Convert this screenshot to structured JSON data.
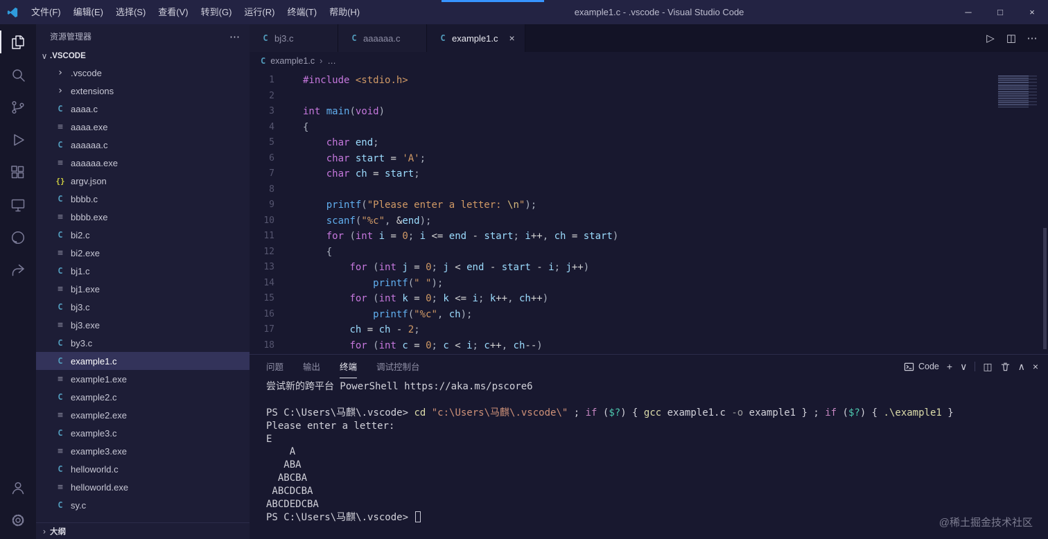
{
  "title_bar": {
    "title": "example1.c - .vscode - Visual Studio Code",
    "menus": [
      {
        "name": "file",
        "label": "文件(F)"
      },
      {
        "name": "edit",
        "label": "编辑(E)"
      },
      {
        "name": "selection",
        "label": "选择(S)"
      },
      {
        "name": "view",
        "label": "查看(V)"
      },
      {
        "name": "go",
        "label": "转到(G)"
      },
      {
        "name": "run",
        "label": "运行(R)"
      },
      {
        "name": "terminal",
        "label": "终端(T)"
      },
      {
        "name": "help",
        "label": "帮助(H)"
      }
    ],
    "window_controls": [
      {
        "name": "minimize",
        "glyph": "─"
      },
      {
        "name": "maximize",
        "glyph": "□"
      },
      {
        "name": "close-window",
        "glyph": "×"
      }
    ]
  },
  "activity_bar": {
    "top": [
      {
        "name": "explorer",
        "active": true
      },
      {
        "name": "search",
        "active": false
      },
      {
        "name": "source-control",
        "active": false
      },
      {
        "name": "run-and-debug",
        "active": false
      },
      {
        "name": "extensions",
        "active": false
      },
      {
        "name": "remote-explorer",
        "active": false
      },
      {
        "name": "github",
        "active": false
      },
      {
        "name": "live-share",
        "active": false
      }
    ],
    "bottom": [
      {
        "name": "account",
        "active": false
      },
      {
        "name": "settings-gear",
        "active": false
      }
    ]
  },
  "icon_glyphs": {
    "folder": "›",
    "c": "C",
    "exe": "≡",
    "json": "{}"
  },
  "sidebar": {
    "header": "资源管理器",
    "header_more": "⋯",
    "section": {
      "label": ".VSCODE",
      "chevron": "∨"
    },
    "items": [
      {
        "label": ".vscode",
        "icon": "folder",
        "selected": false
      },
      {
        "label": "extensions",
        "icon": "folder",
        "selected": false
      },
      {
        "label": "aaaa.c",
        "icon": "c",
        "selected": false
      },
      {
        "label": "aaaa.exe",
        "icon": "exe",
        "selected": false
      },
      {
        "label": "aaaaaa.c",
        "icon": "c",
        "selected": false
      },
      {
        "label": "aaaaaa.exe",
        "icon": "exe",
        "selected": false
      },
      {
        "label": "argv.json",
        "icon": "json",
        "selected": false
      },
      {
        "label": "bbbb.c",
        "icon": "c",
        "selected": false
      },
      {
        "label": "bbbb.exe",
        "icon": "exe",
        "selected": false
      },
      {
        "label": "bi2.c",
        "icon": "c",
        "selected": false
      },
      {
        "label": "bi2.exe",
        "icon": "exe",
        "selected": false
      },
      {
        "label": "bj1.c",
        "icon": "c",
        "selected": false
      },
      {
        "label": "bj1.exe",
        "icon": "exe",
        "selected": false
      },
      {
        "label": "bj3.c",
        "icon": "c",
        "selected": false
      },
      {
        "label": "bj3.exe",
        "icon": "exe",
        "selected": false
      },
      {
        "label": "by3.c",
        "icon": "c",
        "selected": false
      },
      {
        "label": "example1.c",
        "icon": "c",
        "selected": true
      },
      {
        "label": "example1.exe",
        "icon": "exe",
        "selected": false
      },
      {
        "label": "example2.c",
        "icon": "c",
        "selected": false
      },
      {
        "label": "example2.exe",
        "icon": "exe",
        "selected": false
      },
      {
        "label": "example3.c",
        "icon": "c",
        "selected": false
      },
      {
        "label": "example3.exe",
        "icon": "exe",
        "selected": false
      },
      {
        "label": "helloworld.c",
        "icon": "c",
        "selected": false
      },
      {
        "label": "helloworld.exe",
        "icon": "exe",
        "selected": false
      },
      {
        "label": "sy.c",
        "icon": "c",
        "selected": false
      }
    ],
    "outline": {
      "label": "大纲",
      "chevron": "›"
    }
  },
  "editor_tabs": [
    {
      "label": "bj3.c",
      "icon": "c",
      "active": false
    },
    {
      "label": "aaaaaa.c",
      "icon": "c",
      "active": false
    },
    {
      "label": "example1.c",
      "icon": "c",
      "active": true,
      "close": "×"
    }
  ],
  "editor_actions": [
    {
      "name": "run-file",
      "glyph": "▷"
    },
    {
      "name": "split-editor",
      "glyph": "◫"
    },
    {
      "name": "more-actions",
      "glyph": "⋯"
    }
  ],
  "breadcrumb": {
    "file": "example1.c",
    "sep": "›",
    "more": "…"
  },
  "editor": {
    "lines": [
      {
        "n": 1,
        "toks": [
          [
            "kw",
            "#include"
          ],
          [
            "pl",
            " "
          ],
          [
            "str",
            "<stdio.h>"
          ]
        ]
      },
      {
        "n": 2,
        "toks": []
      },
      {
        "n": 3,
        "toks": [
          [
            "kw",
            "int"
          ],
          [
            "pl",
            " "
          ],
          [
            "fn",
            "main"
          ],
          [
            "pl",
            "("
          ],
          [
            "kw",
            "void"
          ],
          [
            "pl",
            ")"
          ]
        ]
      },
      {
        "n": 4,
        "toks": [
          [
            "pl",
            "{"
          ]
        ]
      },
      {
        "n": 5,
        "toks": [
          [
            "pl",
            "    "
          ],
          [
            "kw",
            "char"
          ],
          [
            "pl",
            " "
          ],
          [
            "var",
            "end"
          ],
          [
            "pl",
            ";"
          ]
        ]
      },
      {
        "n": 6,
        "toks": [
          [
            "pl",
            "    "
          ],
          [
            "kw",
            "char"
          ],
          [
            "pl",
            " "
          ],
          [
            "var",
            "start"
          ],
          [
            "op",
            " = "
          ],
          [
            "str",
            "'A'"
          ],
          [
            "pl",
            ";"
          ]
        ]
      },
      {
        "n": 7,
        "toks": [
          [
            "pl",
            "    "
          ],
          [
            "kw",
            "char"
          ],
          [
            "pl",
            " "
          ],
          [
            "var",
            "ch"
          ],
          [
            "op",
            " = "
          ],
          [
            "var",
            "start"
          ],
          [
            "pl",
            ";"
          ]
        ]
      },
      {
        "n": 8,
        "toks": []
      },
      {
        "n": 9,
        "toks": [
          [
            "pl",
            "    "
          ],
          [
            "fn",
            "printf"
          ],
          [
            "pl",
            "("
          ],
          [
            "str",
            "\"Please enter a letter: "
          ],
          [
            "esc",
            "\\n"
          ],
          [
            "str",
            "\""
          ],
          [
            "pl",
            ");"
          ]
        ]
      },
      {
        "n": 10,
        "toks": [
          [
            "pl",
            "    "
          ],
          [
            "fn",
            "scanf"
          ],
          [
            "pl",
            "("
          ],
          [
            "str",
            "\"%c\""
          ],
          [
            "pl",
            ", "
          ],
          [
            "op",
            "&"
          ],
          [
            "var",
            "end"
          ],
          [
            "pl",
            ");"
          ]
        ]
      },
      {
        "n": 11,
        "toks": [
          [
            "pl",
            "    "
          ],
          [
            "kw",
            "for"
          ],
          [
            "pl",
            " ("
          ],
          [
            "kw",
            "int"
          ],
          [
            "pl",
            " "
          ],
          [
            "var",
            "i"
          ],
          [
            "op",
            " = "
          ],
          [
            "num",
            "0"
          ],
          [
            "pl",
            "; "
          ],
          [
            "var",
            "i"
          ],
          [
            "op",
            " <= "
          ],
          [
            "var",
            "end"
          ],
          [
            "op",
            " - "
          ],
          [
            "var",
            "start"
          ],
          [
            "pl",
            "; "
          ],
          [
            "var",
            "i"
          ],
          [
            "op",
            "++"
          ],
          [
            "pl",
            ", "
          ],
          [
            "var",
            "ch"
          ],
          [
            "op",
            " = "
          ],
          [
            "var",
            "start"
          ],
          [
            "pl",
            ")"
          ]
        ]
      },
      {
        "n": 12,
        "toks": [
          [
            "pl",
            "    {"
          ]
        ]
      },
      {
        "n": 13,
        "toks": [
          [
            "pl",
            "        "
          ],
          [
            "kw",
            "for"
          ],
          [
            "pl",
            " ("
          ],
          [
            "kw",
            "int"
          ],
          [
            "pl",
            " "
          ],
          [
            "var",
            "j"
          ],
          [
            "op",
            " = "
          ],
          [
            "num",
            "0"
          ],
          [
            "pl",
            "; "
          ],
          [
            "var",
            "j"
          ],
          [
            "op",
            " < "
          ],
          [
            "var",
            "end"
          ],
          [
            "op",
            " - "
          ],
          [
            "var",
            "start"
          ],
          [
            "op",
            " - "
          ],
          [
            "var",
            "i"
          ],
          [
            "pl",
            "; "
          ],
          [
            "var",
            "j"
          ],
          [
            "op",
            "++"
          ],
          [
            "pl",
            ")"
          ]
        ]
      },
      {
        "n": 14,
        "toks": [
          [
            "pl",
            "            "
          ],
          [
            "fn",
            "printf"
          ],
          [
            "pl",
            "("
          ],
          [
            "str",
            "\" \""
          ],
          [
            "pl",
            ");"
          ]
        ]
      },
      {
        "n": 15,
        "toks": [
          [
            "pl",
            "        "
          ],
          [
            "kw",
            "for"
          ],
          [
            "pl",
            " ("
          ],
          [
            "kw",
            "int"
          ],
          [
            "pl",
            " "
          ],
          [
            "var",
            "k"
          ],
          [
            "op",
            " = "
          ],
          [
            "num",
            "0"
          ],
          [
            "pl",
            "; "
          ],
          [
            "var",
            "k"
          ],
          [
            "op",
            " <= "
          ],
          [
            "var",
            "i"
          ],
          [
            "pl",
            "; "
          ],
          [
            "var",
            "k"
          ],
          [
            "op",
            "++"
          ],
          [
            "pl",
            ", "
          ],
          [
            "var",
            "ch"
          ],
          [
            "op",
            "++"
          ],
          [
            "pl",
            ")"
          ]
        ]
      },
      {
        "n": 16,
        "toks": [
          [
            "pl",
            "            "
          ],
          [
            "fn",
            "printf"
          ],
          [
            "pl",
            "("
          ],
          [
            "str",
            "\"%c\""
          ],
          [
            "pl",
            ", "
          ],
          [
            "var",
            "ch"
          ],
          [
            "pl",
            ");"
          ]
        ]
      },
      {
        "n": 17,
        "toks": [
          [
            "pl",
            "        "
          ],
          [
            "var",
            "ch"
          ],
          [
            "op",
            " = "
          ],
          [
            "var",
            "ch"
          ],
          [
            "op",
            " - "
          ],
          [
            "num",
            "2"
          ],
          [
            "pl",
            ";"
          ]
        ]
      },
      {
        "n": 18,
        "toks": [
          [
            "pl",
            "        "
          ],
          [
            "kw",
            "for"
          ],
          [
            "pl",
            " ("
          ],
          [
            "kw",
            "int"
          ],
          [
            "pl",
            " "
          ],
          [
            "var",
            "c"
          ],
          [
            "op",
            " = "
          ],
          [
            "num",
            "0"
          ],
          [
            "pl",
            "; "
          ],
          [
            "var",
            "c"
          ],
          [
            "op",
            " < "
          ],
          [
            "var",
            "i"
          ],
          [
            "pl",
            "; "
          ],
          [
            "var",
            "c"
          ],
          [
            "op",
            "++"
          ],
          [
            "pl",
            ", "
          ],
          [
            "var",
            "ch"
          ],
          [
            "op",
            "--"
          ],
          [
            "pl",
            ")"
          ]
        ]
      }
    ]
  },
  "panel": {
    "tabs": [
      {
        "name": "problems",
        "label": "问题",
        "active": false
      },
      {
        "name": "output",
        "label": "输出",
        "active": false
      },
      {
        "name": "terminal",
        "label": "终端",
        "active": true
      },
      {
        "name": "debug-console",
        "label": "调试控制台",
        "active": false
      }
    ],
    "shell_label": "Code",
    "actions": [
      {
        "name": "new-terminal",
        "glyph": "+"
      },
      {
        "name": "terminal-dropdown",
        "glyph": "∨"
      },
      {
        "name": "separator",
        "glyph": ""
      },
      {
        "name": "split-terminal",
        "glyph": "◫"
      },
      {
        "name": "kill-terminal",
        "glyph": "trash"
      },
      {
        "name": "maximize-panel",
        "glyph": "∧"
      },
      {
        "name": "close-panel",
        "glyph": "×"
      }
    ]
  },
  "terminal": {
    "lines": [
      {
        "toks": [
          [
            "def",
            "尝试新的跨平台 PowerShell https://aka.ms/pscore6"
          ]
        ],
        "cursor": false
      },
      {
        "toks": [],
        "cursor": false
      },
      {
        "toks": [
          [
            "def",
            "PS C:\\Users\\马麒\\.vscode> "
          ],
          [
            "cmd",
            "cd"
          ],
          [
            "def",
            " "
          ],
          [
            "str",
            "\"c:\\Users\\马麒\\.vscode\\\""
          ],
          [
            "def",
            " ; "
          ],
          [
            "kw",
            "if"
          ],
          [
            "def",
            " ("
          ],
          [
            "var",
            "$?"
          ],
          [
            "def",
            ") { "
          ],
          [
            "cmd",
            "gcc"
          ],
          [
            "def",
            " example1.c "
          ],
          [
            "param",
            "-o"
          ],
          [
            "def",
            " example1 } ; "
          ],
          [
            "kw",
            "if"
          ],
          [
            "def",
            " ("
          ],
          [
            "var",
            "$?"
          ],
          [
            "def",
            ") { "
          ],
          [
            "cmd",
            ".\\example1"
          ],
          [
            "def",
            " }"
          ]
        ],
        "cursor": false
      },
      {
        "toks": [
          [
            "def",
            "Please enter a letter: "
          ]
        ],
        "cursor": false
      },
      {
        "toks": [
          [
            "def",
            "E"
          ]
        ],
        "cursor": false
      },
      {
        "toks": [
          [
            "def",
            "    A"
          ]
        ],
        "cursor": false
      },
      {
        "toks": [
          [
            "def",
            "   ABA"
          ]
        ],
        "cursor": false
      },
      {
        "toks": [
          [
            "def",
            "  ABCBA"
          ]
        ],
        "cursor": false
      },
      {
        "toks": [
          [
            "def",
            " ABCDCBA"
          ]
        ],
        "cursor": false
      },
      {
        "toks": [
          [
            "def",
            "ABCDEDCBA"
          ]
        ],
        "cursor": false
      },
      {
        "toks": [
          [
            "def",
            "PS C:\\Users\\马麒\\.vscode> "
          ]
        ],
        "cursor": true
      }
    ]
  },
  "watermark": "@稀土掘金技术社区"
}
